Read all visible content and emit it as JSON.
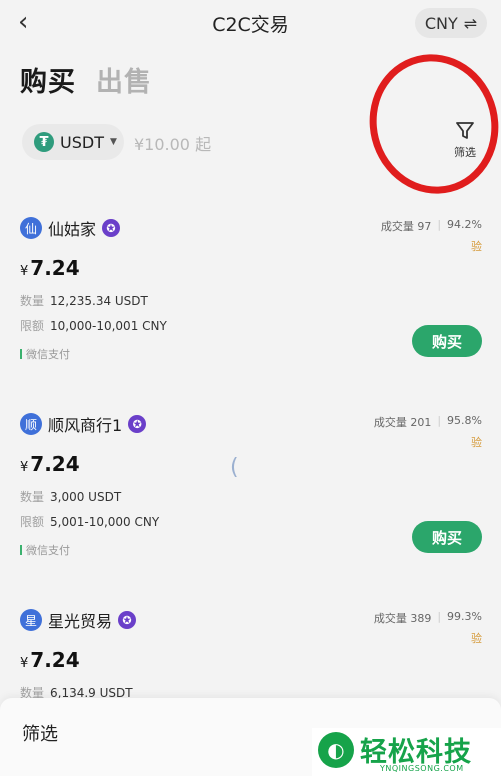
{
  "nav": {
    "back_icon": "chevron-left-icon",
    "title": "C2C交易",
    "currency": "CNY",
    "swap_icon": "swap-icon"
  },
  "tabs": [
    {
      "label": "购买",
      "active": true
    },
    {
      "label": "出售",
      "active": false
    }
  ],
  "filter_bar": {
    "asset": "USDT",
    "amount": "¥10.00 起",
    "filter_label": "筛选"
  },
  "offers": [
    {
      "avatar": "仙",
      "name": "仙姑家",
      "stats_volume": "成交量 97",
      "stats_rate": "94.2%",
      "tag": "验",
      "price_symbol": "¥",
      "price": "7.24",
      "qty_label": "数量",
      "qty": "12,235.34 USDT",
      "limit_label": "限额",
      "limit": "10,000-10,001 CNY",
      "payment": "微信支付",
      "buy_label": "购买"
    },
    {
      "avatar": "顺",
      "name": "顺风商行1",
      "stats_volume": "成交量 201",
      "stats_rate": "95.8%",
      "tag": "验",
      "price_symbol": "¥",
      "price": "7.24",
      "qty_label": "数量",
      "qty": "3,000 USDT",
      "limit_label": "限额",
      "limit": "5,001-10,000 CNY",
      "payment": "微信支付",
      "buy_label": "购买"
    },
    {
      "avatar": "星",
      "name": "星光贸易",
      "stats_volume": "成交量 389",
      "stats_rate": "99.3%",
      "tag": "验",
      "price_symbol": "¥",
      "price": "7.24",
      "qty_label": "数量",
      "qty": "6,134.9 USDT"
    }
  ],
  "bottom_sheet": {
    "title": "筛选"
  },
  "watermark": {
    "text": "轻松科技",
    "sub": "YNQINGSONG.COM"
  },
  "colors": {
    "accent_green": "#2ba66b",
    "annotation_red": "#e01d1d"
  }
}
